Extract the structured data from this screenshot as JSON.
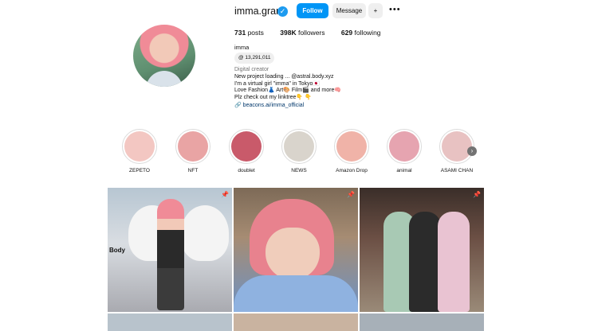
{
  "profile": {
    "username": "imma.gram",
    "verified_glyph": "✓",
    "follow_label": "Follow",
    "message_label": "Message",
    "add_person_glyph": "+",
    "more_glyph": "•••",
    "stats": {
      "posts": "731",
      "posts_label": "posts",
      "followers": "398K",
      "followers_label": "followers",
      "following": "629",
      "following_label": "following"
    },
    "full_name": "imma",
    "threads_count": "13,291,011",
    "category": "Digital creator",
    "bio_lines": [
      "New project loading ... @astral.body.xyz",
      "I'm a virtual girl \"imma\" in Tokyo🇯🇵",
      "Love Fashion👗 Art🎨 Film🎬 and more🧠",
      "Plz check out my linktree👇 👇"
    ],
    "link": "beacons.ai/imma_official"
  },
  "highlights": [
    {
      "label": "ZEPETO",
      "color": "#f3c7c2"
    },
    {
      "label": "NFT",
      "color": "#e9a4a4"
    },
    {
      "label": "doublet",
      "color": "#c95a6a"
    },
    {
      "label": "NEWS",
      "color": "#d9d4cc"
    },
    {
      "label": "Amazon Drop",
      "color": "#f0b3a8"
    },
    {
      "label": "animal",
      "color": "#e6a4b0"
    },
    {
      "label": "ASAMI CHAN",
      "color": "#e8c2c2"
    }
  ],
  "posts": {
    "pinned_glyph": "📌",
    "caption_1": "Body"
  },
  "colors": {
    "accent": "#0095f6",
    "verified": "#1d9bf0",
    "link": "#00376b",
    "muted": "#737373"
  }
}
